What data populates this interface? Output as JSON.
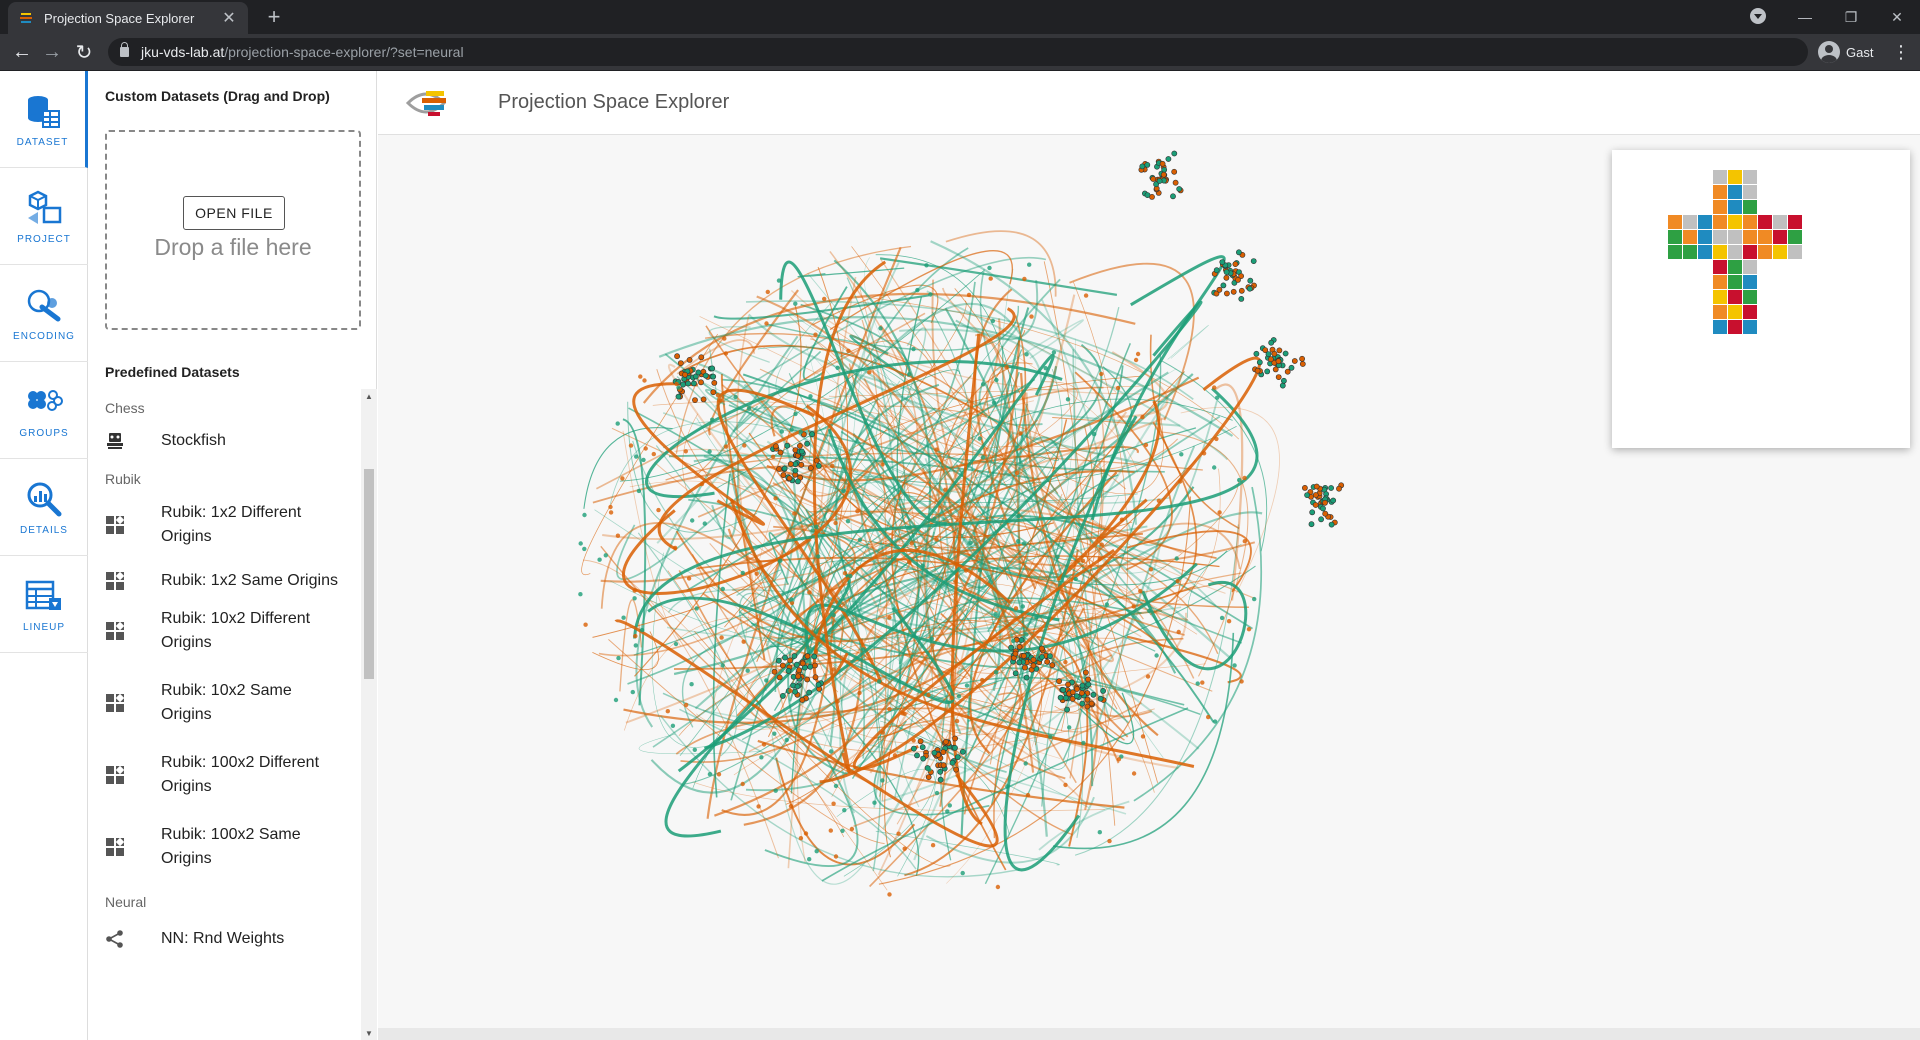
{
  "browser": {
    "tab_title": "Projection Space Explorer",
    "tab_close": "✕",
    "new_tab": "+",
    "url_host": "jku-vds-lab.at",
    "url_path": "/projection-space-explorer/?set=neural",
    "profile_name": "Gast",
    "back": "←",
    "forward": "→",
    "reload": "↻",
    "menu": "⋮",
    "minimize": "—",
    "restore": "❐",
    "close": "✕"
  },
  "sidebar": {
    "items": [
      {
        "label": "DATASET",
        "icon": "dataset-icon",
        "active": true
      },
      {
        "label": "PROJECT",
        "icon": "project-icon"
      },
      {
        "label": "ENCODING",
        "icon": "encoding-icon"
      },
      {
        "label": "GROUPS",
        "icon": "groups-icon"
      },
      {
        "label": "DETAILS",
        "icon": "details-icon"
      },
      {
        "label": "LINEUP",
        "icon": "lineup-icon"
      }
    ],
    "accent": "#1976d2"
  },
  "panel": {
    "custom_heading": "Custom Datasets (Drag and Drop)",
    "open_file": "OPEN FILE",
    "drop_text": "Drop a file here",
    "predefined_heading": "Predefined Datasets",
    "categories": [
      {
        "name": "Chess",
        "items": [
          {
            "label": "Stockfish",
            "icon": "chess-icon"
          }
        ]
      },
      {
        "name": "Rubik",
        "items": [
          {
            "label": "Rubik: 1x2 Different Origins",
            "line1": "Rubik: 1x2 Different",
            "line2": "Origins",
            "icon": "cube-grid-icon"
          },
          {
            "label": "Rubik: 1x2 Same Origins",
            "line1": "Rubik: 1x2 Same Origins",
            "line2": "",
            "icon": "cube-grid-icon"
          },
          {
            "label": "Rubik: 10x2 Different Origins",
            "line1": "Rubik: 10x2 Different",
            "line2": "Origins",
            "icon": "cube-grid-icon"
          },
          {
            "label": "Rubik: 10x2 Same Origins",
            "line1": "Rubik: 10x2 Same",
            "line2": "Origins",
            "icon": "cube-grid-icon"
          },
          {
            "label": "Rubik: 100x2 Different Origins",
            "line1": "Rubik: 100x2 Different",
            "line2": "Origins",
            "icon": "cube-grid-icon"
          },
          {
            "label": "Rubik: 100x2 Same Origins",
            "line1": "Rubik: 100x2 Same",
            "line2": "Origins",
            "icon": "cube-grid-icon"
          }
        ]
      },
      {
        "name": "Neural",
        "items": [
          {
            "label": "NN: Rnd Weights",
            "icon": "share-icon"
          }
        ]
      }
    ]
  },
  "main": {
    "title": "Projection Space Explorer",
    "series_colors": {
      "teal": "#1b9e77",
      "orange": "#d95f02"
    }
  },
  "preview": {
    "cube_colors": {
      "W": "#c0c0c0",
      "Y": "#f4c400",
      "B": "#1f8bc0",
      "G": "#2ea043",
      "O": "#f08a24",
      "R": "#c8102e"
    },
    "cube_rows": [
      [
        "",
        "",
        "",
        "W",
        "Y",
        "W",
        "",
        "",
        ""
      ],
      [
        "",
        "",
        "",
        "O",
        "B",
        "W",
        "",
        "",
        ""
      ],
      [
        "",
        "",
        "",
        "O",
        "B",
        "G",
        "",
        "",
        ""
      ],
      [
        "O",
        "W",
        "B",
        "O",
        "Y",
        "O",
        "R",
        "W",
        "R"
      ],
      [
        "G",
        "O",
        "B",
        "W",
        "W",
        "O",
        "O",
        "R",
        "G"
      ],
      [
        "G",
        "G",
        "B",
        "Y",
        "W",
        "R",
        "O",
        "Y",
        "W"
      ],
      [
        "",
        "",
        "",
        "R",
        "G",
        "W",
        "",
        "",
        ""
      ],
      [
        "",
        "",
        "",
        "O",
        "G",
        "B",
        "",
        "",
        ""
      ],
      [
        "",
        "",
        "",
        "Y",
        "R",
        "G",
        "",
        "",
        ""
      ],
      [
        "",
        "",
        "",
        "O",
        "Y",
        "R",
        "",
        "",
        ""
      ],
      [
        "",
        "",
        "",
        "B",
        "R",
        "B",
        "",
        "",
        ""
      ]
    ]
  }
}
